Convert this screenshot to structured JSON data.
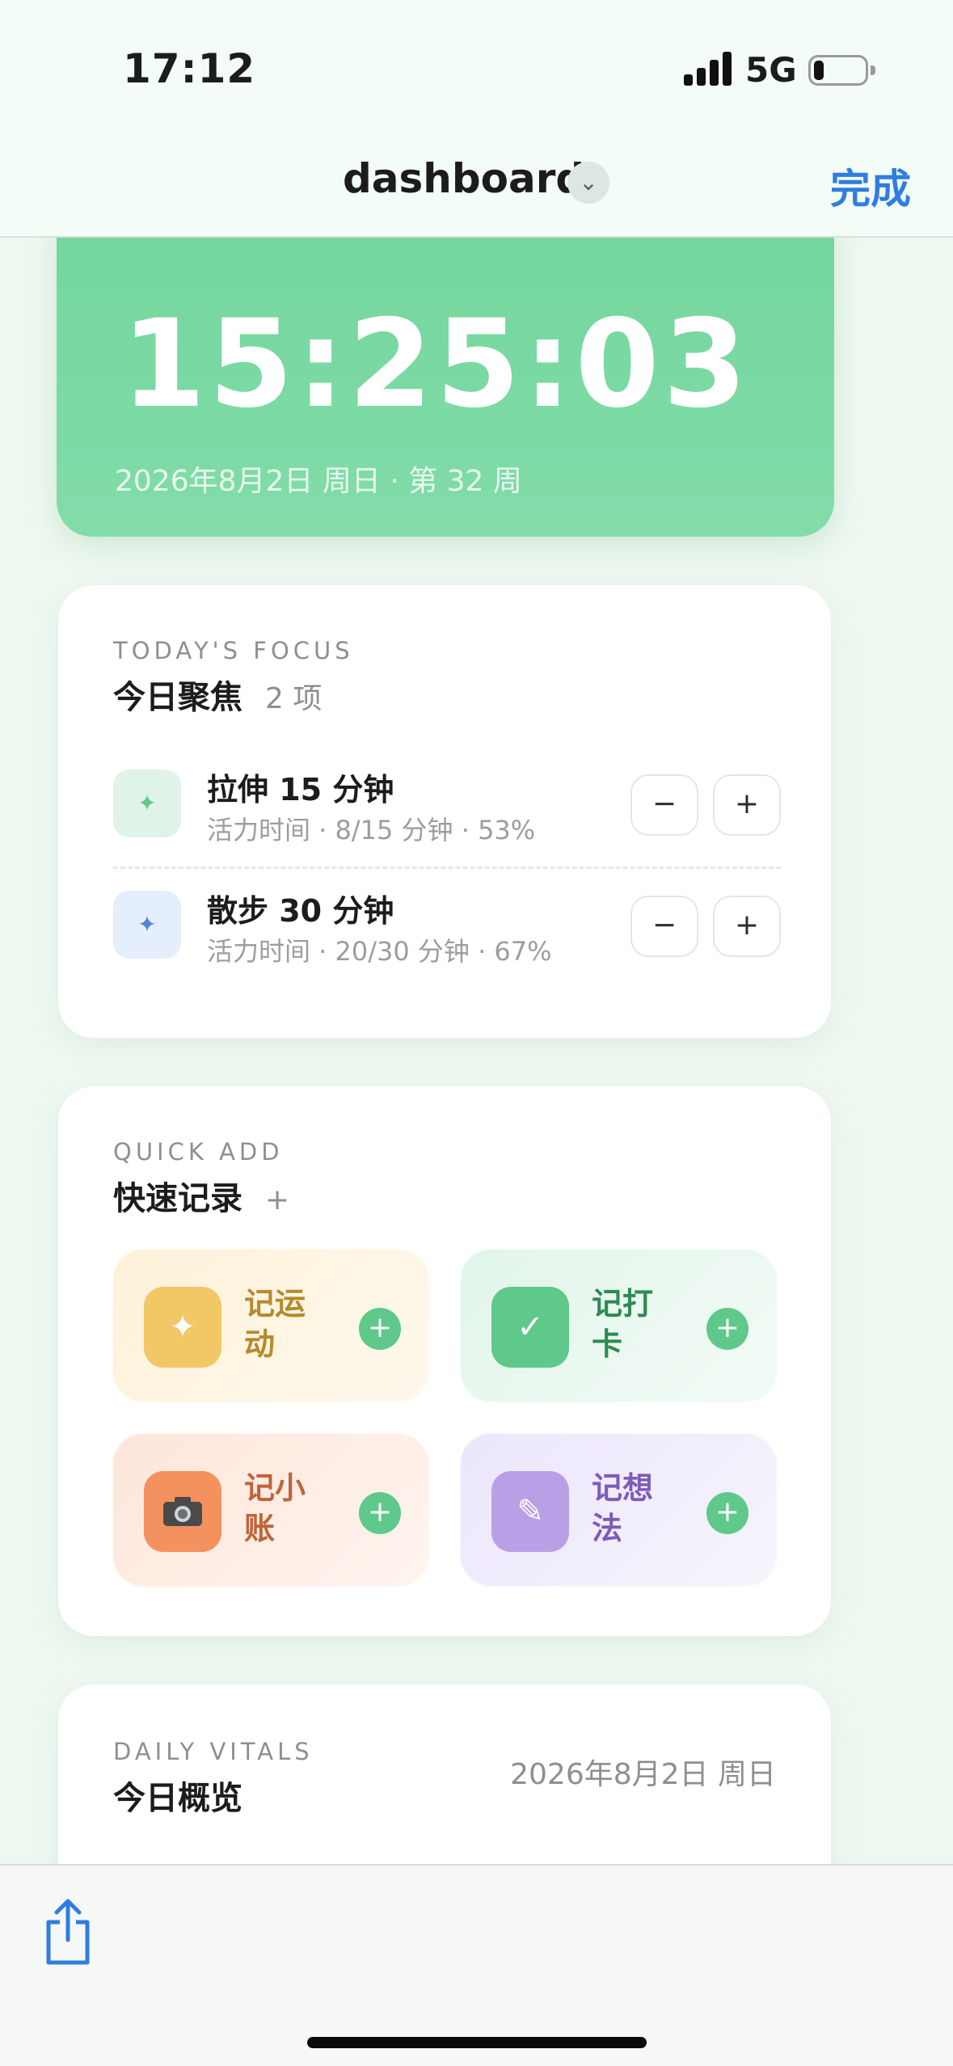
{
  "status_bar": {
    "time": "17:12",
    "network": "5G"
  },
  "nav": {
    "title": "dashboard",
    "done_label": "完成"
  },
  "clock": {
    "time": "15:25:03",
    "date_line": "2026年8月2日 周日 · 第 32 周"
  },
  "focus": {
    "eyebrow": "TODAY'S FOCUS",
    "title": "今日聚焦",
    "count": "2 项",
    "items": [
      {
        "name": "拉伸 15 分钟",
        "meta": "活力时间 · 8/15 分钟 · 53%",
        "icon": "sparkle-icon",
        "color": "#dff3e6",
        "progress": 0.53
      },
      {
        "name": "散步 30 分钟",
        "meta": "活力时间 · 20/30 分钟 · 67%",
        "icon": "sparkle-icon",
        "color": "#e4eefd",
        "progress": 0.67
      }
    ],
    "minus": "−",
    "plus": "+"
  },
  "quick_add": {
    "eyebrow": "QUICK ADD",
    "title": "快速记录",
    "title_plus": "+",
    "tiles": [
      {
        "label": "记运动",
        "icon": "sparkle-icon",
        "icon_bg": "#f2c766",
        "text_color": "#b68a2c",
        "tile_bg": "#fdf1d8"
      },
      {
        "label": "记打卡",
        "icon": "check-icon",
        "icon_bg": "#5ec98a",
        "text_color": "#2e8a54",
        "tile_bg": "#e2f5ea"
      },
      {
        "label": "记小账",
        "icon": "camera-icon",
        "icon_bg": "#f3925e",
        "text_color": "#c0643a",
        "tile_bg": "#fde6da"
      },
      {
        "label": "记想法",
        "icon": "pencil-icon",
        "icon_bg": "#b9a0e6",
        "text_color": "#7d5cb8",
        "tile_bg": "#ece6fb"
      }
    ],
    "add_symbol": "+"
  },
  "vitals": {
    "eyebrow": "DAILY VITALS",
    "title": "今日概览",
    "date": "2026年8月2日 周日"
  },
  "colors": {
    "accent_green": "#73d69c",
    "link_blue": "#2f7de1"
  }
}
